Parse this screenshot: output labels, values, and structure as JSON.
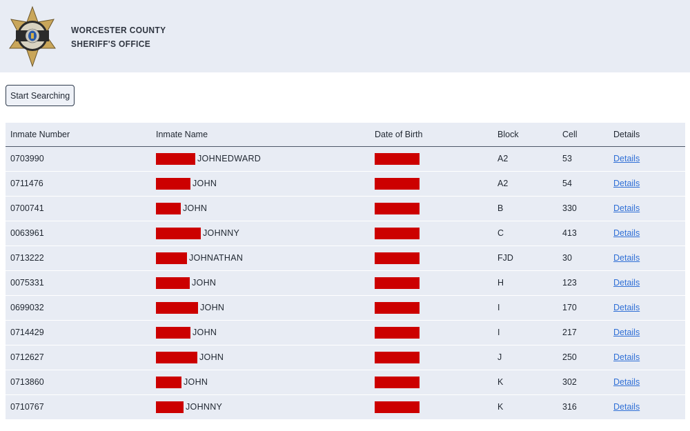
{
  "header": {
    "logo_icon": "sheriff-star-badge-icon",
    "title_line1": "WORCESTER COUNTY",
    "title_line2": "SHERIFF'S OFFICE"
  },
  "search": {
    "button_label": "Start Searching"
  },
  "colors": {
    "redaction": "#cc0000",
    "link": "#2f6fd6",
    "row_bg": "#e8ecf4"
  },
  "table": {
    "columns": [
      "Inmate Number",
      "Inmate Name",
      "Date of Birth",
      "Block",
      "Cell",
      "Details"
    ],
    "rows": [
      {
        "number": "0703990",
        "name_visible": "JOHNEDWARD",
        "name_redacted": true,
        "dob_redacted": true,
        "block": "A2",
        "cell": "53",
        "details": "Details"
      },
      {
        "number": "0711476",
        "name_visible": "JOHN",
        "name_redacted": true,
        "dob_redacted": true,
        "block": "A2",
        "cell": "54",
        "details": "Details"
      },
      {
        "number": "0700741",
        "name_visible": "JOHN",
        "name_redacted": true,
        "dob_redacted": true,
        "block": "B",
        "cell": "330",
        "details": "Details"
      },
      {
        "number": "0063961",
        "name_visible": "JOHNNY",
        "name_redacted": true,
        "dob_redacted": true,
        "block": "C",
        "cell": "413",
        "details": "Details"
      },
      {
        "number": "0713222",
        "name_visible": "JOHNATHAN",
        "name_redacted": true,
        "dob_redacted": true,
        "block": "FJD",
        "cell": "30",
        "details": "Details"
      },
      {
        "number": "0075331",
        "name_visible": "JOHN",
        "name_redacted": true,
        "dob_redacted": true,
        "block": "H",
        "cell": "123",
        "details": "Details"
      },
      {
        "number": "0699032",
        "name_visible": "JOHN",
        "name_redacted": true,
        "dob_redacted": true,
        "block": "I",
        "cell": "170",
        "details": "Details"
      },
      {
        "number": "0714429",
        "name_visible": "JOHN",
        "name_redacted": true,
        "dob_redacted": true,
        "block": "I",
        "cell": "217",
        "details": "Details"
      },
      {
        "number": "0712627",
        "name_visible": "JOHN",
        "name_redacted": true,
        "dob_redacted": true,
        "block": "J",
        "cell": "250",
        "details": "Details"
      },
      {
        "number": "0713860",
        "name_visible": "JOHN",
        "name_redacted": true,
        "dob_redacted": true,
        "block": "K",
        "cell": "302",
        "details": "Details"
      },
      {
        "number": "0710767",
        "name_visible": "JOHNNY",
        "name_redacted": true,
        "dob_redacted": true,
        "block": "K",
        "cell": "316",
        "details": "Details"
      }
    ]
  }
}
